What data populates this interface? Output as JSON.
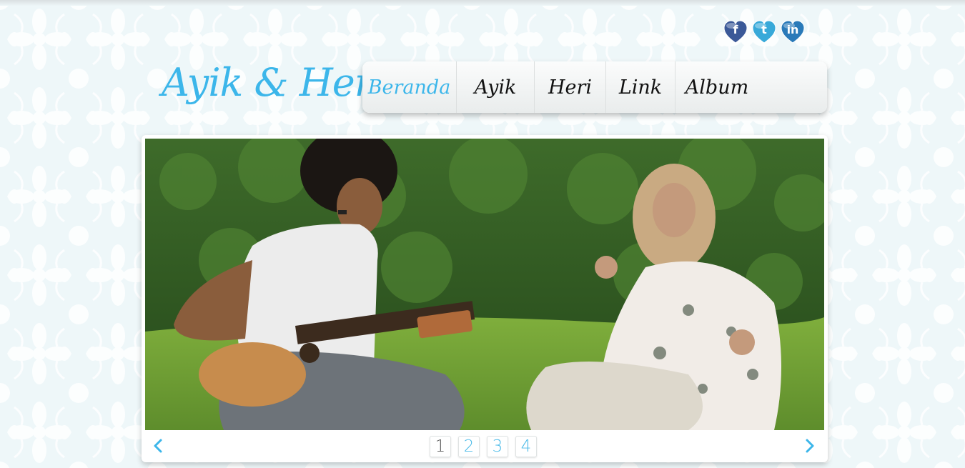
{
  "site": {
    "logo_text": "Ayik & Heri",
    "accent_color": "#3cb6ea"
  },
  "social": [
    {
      "name": "facebook",
      "glyph": "f",
      "color": "#3b5998",
      "icon": "facebook-heart-icon"
    },
    {
      "name": "twitter",
      "glyph": "t",
      "color": "#38a9d9",
      "icon": "twitter-heart-icon"
    },
    {
      "name": "linkedin",
      "glyph": "in",
      "color": "#2a7ab9",
      "icon": "linkedin-heart-icon"
    }
  ],
  "nav": {
    "items": [
      {
        "label": "Beranda",
        "active": true
      },
      {
        "label": "Ayik",
        "active": false
      },
      {
        "label": "Heri",
        "active": false
      },
      {
        "label": "Link",
        "active": false
      },
      {
        "label": "Album",
        "active": false
      }
    ]
  },
  "slider": {
    "prev_icon": "chevron-left-icon",
    "next_icon": "chevron-right-icon",
    "pages": [
      "1",
      "2",
      "3",
      "4"
    ],
    "current_page": "1"
  }
}
